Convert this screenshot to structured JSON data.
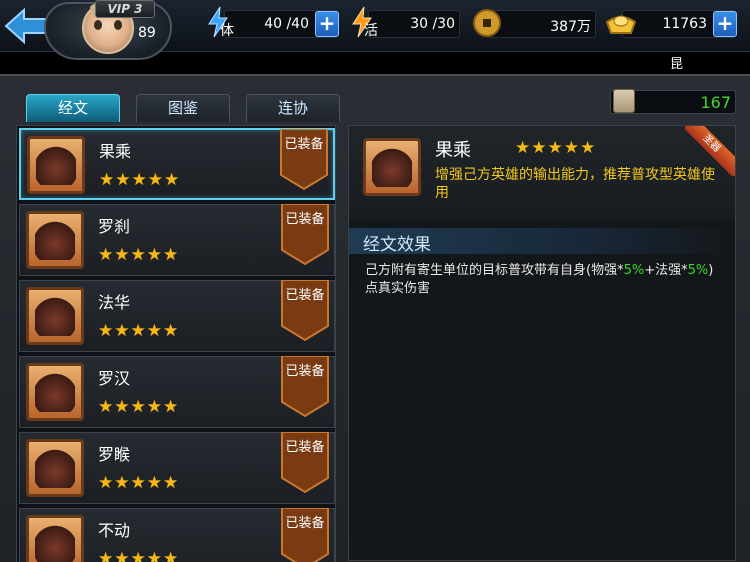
{
  "topbar": {
    "vip": "VIP 3",
    "level": "89",
    "stamina_label": "体",
    "stamina": "40 /40",
    "vitality_label": "活",
    "vitality": "30 /30",
    "coins": "387万",
    "gold": "11763",
    "plus": "+"
  },
  "strip": {
    "text": "昆"
  },
  "tabs": [
    "经文",
    "图鉴",
    "连协"
  ],
  "counter": {
    "value": "167"
  },
  "list": {
    "items": [
      {
        "name": "果乘",
        "stars": "★★★★★",
        "status": "已装备"
      },
      {
        "name": "罗刹",
        "stars": "★★★★★",
        "status": "已装备"
      },
      {
        "name": "法华",
        "stars": "★★★★★",
        "status": "已装备"
      },
      {
        "name": "罗汉",
        "stars": "★★★★★",
        "status": "已装备"
      },
      {
        "name": "罗睺",
        "stars": "★★★★★",
        "status": "已装备"
      },
      {
        "name": "不动",
        "stars": "★★★★★",
        "status": "已装备"
      }
    ]
  },
  "detail": {
    "name": "果乘",
    "stars": "★★★★★",
    "ribbon": "圣器",
    "description": "增强己方英雄的输出能力，推荐普攻型英雄使用",
    "section_title": "经文效果",
    "effect_part1": "己方附有寄生单位的目标普攻带有自身(物强*",
    "effect_pct1": "5%",
    "effect_part2": "+法强*",
    "effect_pct2": "5%",
    "effect_part3": ")点真实伤害"
  },
  "colors": {
    "accent": "#5ad0ee",
    "star": "#f4b818",
    "description": "#f2c71c",
    "highlight": "#39d82a",
    "counter": "#3cdc2a"
  }
}
